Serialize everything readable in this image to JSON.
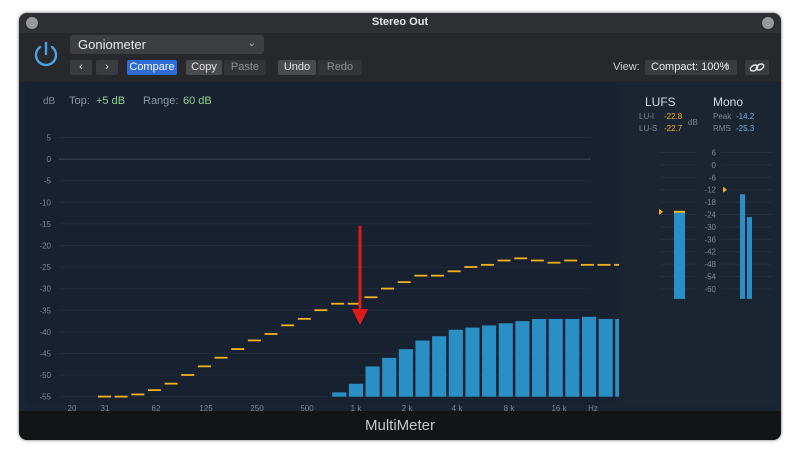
{
  "window": {
    "title": "Stereo Out"
  },
  "toolbar": {
    "preset": "Goniometer",
    "compare": "Compare",
    "copy": "Copy",
    "paste": "Paste",
    "undo": "Undo",
    "redo": "Redo",
    "view_label": "View:",
    "view_value": "Compact: 100%"
  },
  "analyzer": {
    "unit": "dB",
    "top_label": "Top:",
    "top_value": "+5 dB",
    "range_label": "Range:",
    "range_value": "60 dB",
    "y_ticks": [
      "5",
      "0",
      "-5",
      "-10",
      "-15",
      "-20",
      "-25",
      "-30",
      "-35",
      "-40",
      "-45",
      "-50",
      "-55"
    ],
    "x_ticks": [
      "20",
      "31",
      "62",
      "125",
      "250",
      "500",
      "1 k",
      "2 k",
      "4 k",
      "8 k",
      "16 k",
      "Hz"
    ]
  },
  "lufs": {
    "title": "LUFS",
    "unit": "dB",
    "lui_label": "LU-I",
    "lui_value": "-22.8",
    "lus_label": "LU-S",
    "lus_value": "-22.7",
    "scale": [
      "6",
      "0",
      "-6",
      "-12",
      "-18",
      "-24",
      "-30",
      "-36",
      "-42",
      "-48",
      "-54",
      "-60"
    ],
    "level": -22.7
  },
  "mono": {
    "title": "Mono",
    "peak_label": "Peak",
    "peak_value": "-14.2",
    "rms_label": "RMS",
    "rms_value": "-25.3",
    "scale": [
      "6",
      "0",
      "-6",
      "-12",
      "-18",
      "-24",
      "-30",
      "-36",
      "-42",
      "-48",
      "-54",
      "-60"
    ],
    "peak": -14.2,
    "rms": -25.3
  },
  "footer": {
    "title": "MultiMeter"
  },
  "colors": {
    "bar": "#2a8fc4",
    "peak_hold": "#f2b31c",
    "accent": "#2e6bd6",
    "value_green": "#8fd18f"
  },
  "chart_data": {
    "type": "bar",
    "title": "",
    "ylabel": "dB",
    "xlabel": "Hz",
    "ylim": [
      -55,
      5
    ],
    "series": [
      {
        "name": "",
        "values": [
          -55,
          -55,
          -55,
          -55,
          -55,
          -55,
          -55,
          -55,
          -54,
          -52,
          -48,
          -46,
          -44,
          -42,
          -41,
          -39.5,
          -39,
          -38.5,
          -38,
          -37.5,
          -37,
          -37,
          -37,
          -36.5,
          -37,
          -37,
          -37.5,
          -38,
          -38.5,
          -39.5,
          -44
        ]
      },
      {
        "name": "",
        "values": [
          -55,
          -55,
          -54.5,
          -53.5,
          -52,
          -50,
          -48,
          -46,
          -44,
          -42,
          -40.5,
          -38.5,
          -37,
          -35,
          -33.5,
          -33.5,
          -32,
          -30,
          -28.5,
          -27,
          -27,
          -26,
          -25,
          -24.5,
          -23.5,
          -23,
          -23.5,
          -24,
          -23.5,
          -24.5,
          -24.5,
          -24.5,
          -25,
          -25.5,
          -30.5
        ]
      }
    ]
  }
}
